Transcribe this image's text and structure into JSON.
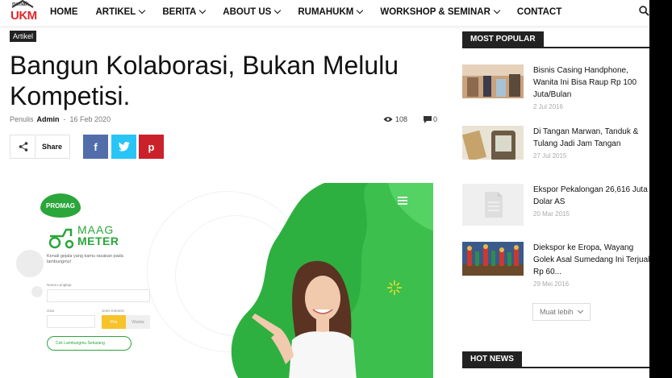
{
  "logo": {
    "small": "rumah",
    "big": "UKM"
  },
  "nav": {
    "items": [
      {
        "label": "HOME",
        "dropdown": false
      },
      {
        "label": "ARTIKEL",
        "dropdown": true
      },
      {
        "label": "BERITA",
        "dropdown": true
      },
      {
        "label": "ABOUT US",
        "dropdown": true
      },
      {
        "label": "RUMAHUKM",
        "dropdown": true
      },
      {
        "label": "WORKSHOP & SEMINAR",
        "dropdown": true
      },
      {
        "label": "CONTACT",
        "dropdown": false
      }
    ],
    "search_icon": "search-icon"
  },
  "article": {
    "category": "Artikel",
    "title": "Bangun Kolaborasi, Bukan Melulu Kompetisi.",
    "author_prefix": "Penulis",
    "author": "Admin",
    "separator": "-",
    "date": "16 Feb 2020",
    "views": "108",
    "comments": "0",
    "share_label": "Share",
    "social": {
      "facebook": "f",
      "pinterest": "p"
    }
  },
  "hero": {
    "badge": "PROMAG",
    "maag": "MAAG",
    "meter": "METER",
    "hint": "Kenali gejala yang kamu rasakan pada lambungmu!",
    "label_name": "Nama Lengkap",
    "label_age": "Usia",
    "label_gender": "Jenis Kelamin",
    "btn_pria": "Pria",
    "btn_wanita": "Wanita",
    "btn_cek": "Cek Lambungmu Sekarang"
  },
  "sidebar": {
    "popular_heading": "MOST POPULAR",
    "posts": [
      {
        "title": "Bisnis Casing Handphone, Wanita Ini Bisa Raup Rp 100 Juta/Bulan",
        "date": "2 Jul 2016"
      },
      {
        "title": "Di Tangan Marwan, Tanduk & Tulang Jadi Jam Tangan",
        "date": "27 Jul 2015"
      },
      {
        "title": "Ekspor Pekalongan 26,616 Juta Dolar AS",
        "date": "20 Mar 2015"
      },
      {
        "title": "Diekspor ke Eropa, Wayang Golek Asal Sumedang Ini Terjual Rp 60...",
        "date": "29 Mei 2016"
      }
    ],
    "more_label": "Muat lebih",
    "hot_heading": "HOT NEWS"
  },
  "colors": {
    "brand_red": "#e0262b",
    "facebook": "#516eab",
    "twitter": "#29c5f6",
    "pinterest": "#ca212a",
    "promag_green": "#2aa63a"
  }
}
